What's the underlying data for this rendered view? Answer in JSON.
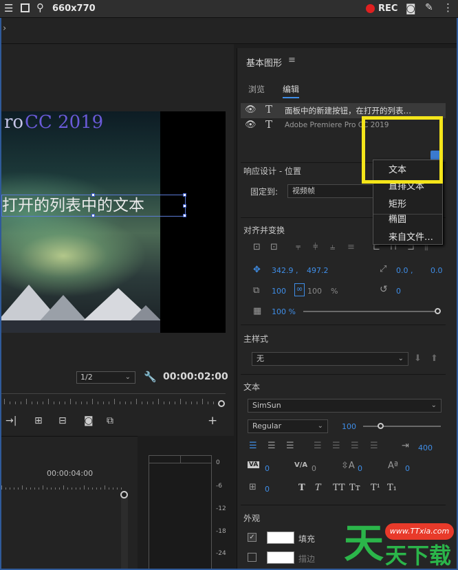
{
  "topbar": {
    "size": "660x770",
    "rec": "REC"
  },
  "monitor": {
    "video_title_1": "ro",
    "video_title_2": "CC 2019",
    "video_text": "打开的列表中的文本",
    "zoom": "1/2",
    "timecode": "00:00:02:00"
  },
  "timeline": {
    "time": "00:00:04:00",
    "meter_labels": [
      "0",
      "-6",
      "-12",
      "-18",
      "-24"
    ]
  },
  "panel": {
    "title": "基本图形",
    "tabs": [
      "浏览",
      "编辑"
    ],
    "layers": [
      {
        "name": "面板中的新建按钮，在打开的列表…",
        "selected": true
      },
      {
        "name": "Adobe Premiere Pro CC 2019",
        "selected": false
      }
    ],
    "responsive_title": "响应设计 - 位置",
    "pin_label": "固定到:",
    "pin_value": "视频帧",
    "align_title": "对齐并变换",
    "pos_x": "342.9 ,",
    "pos_y": "497.2",
    "anchor_x": "0.0 ,",
    "anchor_y": "0.0",
    "scale": "100",
    "scale2": "100",
    "pct": "%",
    "rotation": "0",
    "opacity": "100 %",
    "master_style_title": "主样式",
    "master_style_value": "无",
    "text_title": "文本",
    "font": "SimSun",
    "font_style": "Regular",
    "font_size": "100",
    "tab_size": "400",
    "kerning": "0",
    "tracking": "0",
    "leading": "0",
    "baseline": "0",
    "tsume": "0",
    "appearance_title": "外观",
    "fill_label": "填充",
    "stroke_label": "描边",
    "type_buttons": [
      "T",
      "T",
      "TT",
      "Tт",
      "T¹",
      "T₁"
    ]
  },
  "popup_menu": {
    "items": [
      "文本",
      "直排文本",
      "矩形",
      "椭圆",
      "来自文件…"
    ]
  },
  "watermark": {
    "url": "www.TTxia.com",
    "chars": "天天下载"
  },
  "colors": {
    "accent": "#3f8ee8",
    "highlight": "#f4e51a",
    "rec": "#e02020"
  }
}
